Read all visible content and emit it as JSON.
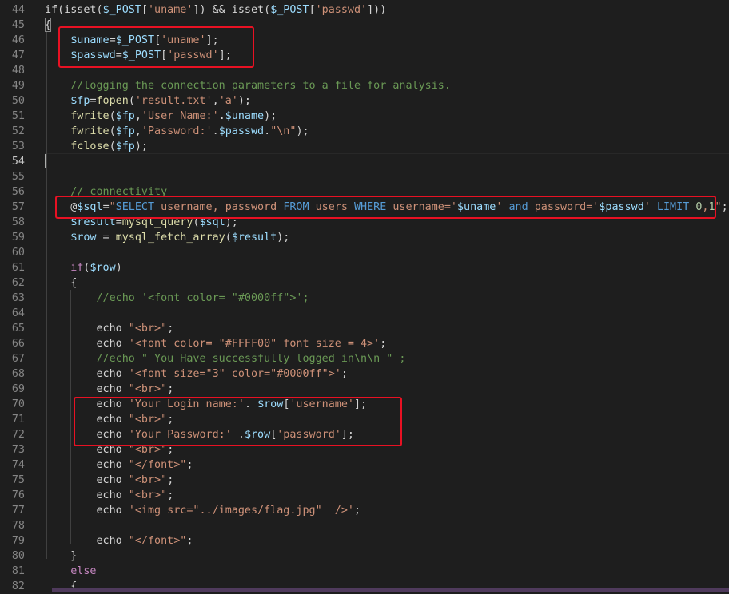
{
  "colors": {
    "background": "#1e1e1e",
    "line_number": "#858585",
    "highlight_box": "#e81123",
    "keyword": "#569cd6",
    "control": "#c586c0",
    "variable": "#9cdcfe",
    "function": "#dcdcaa",
    "string": "#ce9178",
    "comment": "#6a9955",
    "number": "#b5cea8"
  },
  "cursor_line": 54,
  "editor": {
    "lines": [
      {
        "n": "44",
        "tokens": [
          [
            "pl",
            "if(isset("
          ],
          [
            "var",
            "$_POST"
          ],
          [
            "pl",
            "["
          ],
          [
            "str",
            "'uname'"
          ],
          [
            "pl",
            "]) && isset("
          ],
          [
            "var",
            "$_POST"
          ],
          [
            "pl",
            "["
          ],
          [
            "str",
            "'passwd'"
          ],
          [
            "pl",
            "]))"
          ]
        ]
      },
      {
        "n": "45",
        "tokens": [
          [
            "pl",
            "{"
          ]
        ]
      },
      {
        "n": "46",
        "tokens": [
          [
            "pl",
            "    "
          ],
          [
            "var",
            "$uname"
          ],
          [
            "pl",
            "="
          ],
          [
            "var",
            "$_POST"
          ],
          [
            "pl",
            "["
          ],
          [
            "str",
            "'uname'"
          ],
          [
            "pl",
            "];"
          ]
        ]
      },
      {
        "n": "47",
        "tokens": [
          [
            "pl",
            "    "
          ],
          [
            "var",
            "$passwd"
          ],
          [
            "pl",
            "="
          ],
          [
            "var",
            "$_POST"
          ],
          [
            "pl",
            "["
          ],
          [
            "str",
            "'passwd'"
          ],
          [
            "pl",
            "];"
          ]
        ]
      },
      {
        "n": "48",
        "tokens": []
      },
      {
        "n": "49",
        "tokens": [
          [
            "pl",
            "    "
          ],
          [
            "cm",
            "//logging the connection parameters to a file for analysis."
          ]
        ]
      },
      {
        "n": "50",
        "tokens": [
          [
            "pl",
            "    "
          ],
          [
            "var",
            "$fp"
          ],
          [
            "pl",
            "="
          ],
          [
            "fn",
            "fopen"
          ],
          [
            "pl",
            "("
          ],
          [
            "str",
            "'result.txt'"
          ],
          [
            "pl",
            ","
          ],
          [
            "str",
            "'a'"
          ],
          [
            "pl",
            ");"
          ]
        ]
      },
      {
        "n": "51",
        "tokens": [
          [
            "pl",
            "    "
          ],
          [
            "fn",
            "fwrite"
          ],
          [
            "pl",
            "("
          ],
          [
            "var",
            "$fp"
          ],
          [
            "pl",
            ","
          ],
          [
            "str",
            "'User Name:'"
          ],
          [
            "pl",
            "."
          ],
          [
            "var",
            "$uname"
          ],
          [
            "pl",
            ");"
          ]
        ]
      },
      {
        "n": "52",
        "tokens": [
          [
            "pl",
            "    "
          ],
          [
            "fn",
            "fwrite"
          ],
          [
            "pl",
            "("
          ],
          [
            "var",
            "$fp"
          ],
          [
            "pl",
            ","
          ],
          [
            "str",
            "'Password:'"
          ],
          [
            "pl",
            "."
          ],
          [
            "var",
            "$passwd"
          ],
          [
            "pl",
            "."
          ],
          [
            "str",
            "\"\\n\""
          ],
          [
            "pl",
            ");"
          ]
        ]
      },
      {
        "n": "53",
        "tokens": [
          [
            "pl",
            "    "
          ],
          [
            "fn",
            "fclose"
          ],
          [
            "pl",
            "("
          ],
          [
            "var",
            "$fp"
          ],
          [
            "pl",
            ");"
          ]
        ]
      },
      {
        "n": "54",
        "tokens": []
      },
      {
        "n": "55",
        "tokens": []
      },
      {
        "n": "56",
        "tokens": [
          [
            "pl",
            "    "
          ],
          [
            "cm",
            "// connectivity"
          ]
        ]
      },
      {
        "n": "57",
        "tokens": [
          [
            "pl",
            "    @"
          ],
          [
            "var",
            "$sql"
          ],
          [
            "pl",
            "="
          ],
          [
            "str",
            "\""
          ],
          [
            "kw",
            "SELECT"
          ],
          [
            "str",
            " username, password "
          ],
          [
            "kw",
            "FROM"
          ],
          [
            "str",
            " users "
          ],
          [
            "kw",
            "WHERE"
          ],
          [
            "str",
            " username='"
          ],
          [
            "var",
            "$uname"
          ],
          [
            "str",
            "' "
          ],
          [
            "kw",
            "and"
          ],
          [
            "str",
            " password='"
          ],
          [
            "var",
            "$passwd"
          ],
          [
            "str",
            "' "
          ],
          [
            "kw",
            "LIMIT"
          ],
          [
            "str",
            " "
          ],
          [
            "num",
            "0"
          ],
          [
            "str",
            ","
          ],
          [
            "num",
            "1"
          ],
          [
            "str",
            "\""
          ],
          [
            "pl",
            ";"
          ]
        ]
      },
      {
        "n": "58",
        "tokens": [
          [
            "pl",
            "    "
          ],
          [
            "var",
            "$result"
          ],
          [
            "pl",
            "="
          ],
          [
            "fn",
            "mysql_query"
          ],
          [
            "pl",
            "("
          ],
          [
            "var",
            "$sql"
          ],
          [
            "pl",
            ");"
          ]
        ]
      },
      {
        "n": "59",
        "tokens": [
          [
            "pl",
            "    "
          ],
          [
            "var",
            "$row"
          ],
          [
            "pl",
            " = "
          ],
          [
            "fn",
            "mysql_fetch_array"
          ],
          [
            "pl",
            "("
          ],
          [
            "var",
            "$result"
          ],
          [
            "pl",
            ");"
          ]
        ]
      },
      {
        "n": "60",
        "tokens": []
      },
      {
        "n": "61",
        "tokens": [
          [
            "pl",
            "    "
          ],
          [
            "ctl",
            "if"
          ],
          [
            "pl",
            "("
          ],
          [
            "var",
            "$row"
          ],
          [
            "pl",
            ")"
          ]
        ]
      },
      {
        "n": "62",
        "tokens": [
          [
            "pl",
            "    {"
          ]
        ]
      },
      {
        "n": "63",
        "tokens": [
          [
            "pl",
            "        "
          ],
          [
            "cm",
            "//echo '<font color= \"#0000ff\">';"
          ]
        ]
      },
      {
        "n": "64",
        "tokens": []
      },
      {
        "n": "65",
        "tokens": [
          [
            "pl",
            "        echo "
          ],
          [
            "str",
            "\"<br>\""
          ],
          [
            "pl",
            ";"
          ]
        ]
      },
      {
        "n": "66",
        "tokens": [
          [
            "pl",
            "        echo "
          ],
          [
            "str",
            "'<font color= \"#FFFF00\" font size = 4>'"
          ],
          [
            "pl",
            ";"
          ]
        ]
      },
      {
        "n": "67",
        "tokens": [
          [
            "pl",
            "        "
          ],
          [
            "cm",
            "//echo \" You Have successfully logged in\\n\\n \" ;"
          ]
        ]
      },
      {
        "n": "68",
        "tokens": [
          [
            "pl",
            "        echo "
          ],
          [
            "str",
            "'<font size=\"3\" color=\"#0000ff\">'"
          ],
          [
            "pl",
            ";"
          ]
        ]
      },
      {
        "n": "69",
        "tokens": [
          [
            "pl",
            "        echo "
          ],
          [
            "str",
            "\"<br>\""
          ],
          [
            "pl",
            ";"
          ]
        ]
      },
      {
        "n": "70",
        "tokens": [
          [
            "pl",
            "        echo "
          ],
          [
            "str",
            "'Your Login name:'"
          ],
          [
            "pl",
            ". "
          ],
          [
            "var",
            "$row"
          ],
          [
            "pl",
            "["
          ],
          [
            "str",
            "'username'"
          ],
          [
            "pl",
            "];"
          ]
        ]
      },
      {
        "n": "71",
        "tokens": [
          [
            "pl",
            "        echo "
          ],
          [
            "str",
            "\"<br>\""
          ],
          [
            "pl",
            ";"
          ]
        ]
      },
      {
        "n": "72",
        "tokens": [
          [
            "pl",
            "        echo "
          ],
          [
            "str",
            "'Your Password:'"
          ],
          [
            "pl",
            " ."
          ],
          [
            "var",
            "$row"
          ],
          [
            "pl",
            "["
          ],
          [
            "str",
            "'password'"
          ],
          [
            "pl",
            "];"
          ]
        ]
      },
      {
        "n": "73",
        "tokens": [
          [
            "pl",
            "        echo "
          ],
          [
            "str",
            "\"<br>\""
          ],
          [
            "pl",
            ";"
          ]
        ]
      },
      {
        "n": "74",
        "tokens": [
          [
            "pl",
            "        echo "
          ],
          [
            "str",
            "\"</font>\""
          ],
          [
            "pl",
            ";"
          ]
        ]
      },
      {
        "n": "75",
        "tokens": [
          [
            "pl",
            "        echo "
          ],
          [
            "str",
            "\"<br>\""
          ],
          [
            "pl",
            ";"
          ]
        ]
      },
      {
        "n": "76",
        "tokens": [
          [
            "pl",
            "        echo "
          ],
          [
            "str",
            "\"<br>\""
          ],
          [
            "pl",
            ";"
          ]
        ]
      },
      {
        "n": "77",
        "tokens": [
          [
            "pl",
            "        echo "
          ],
          [
            "str",
            "'<img src=\"../images/flag.jpg\"  />'"
          ],
          [
            "pl",
            ";"
          ]
        ]
      },
      {
        "n": "78",
        "tokens": []
      },
      {
        "n": "79",
        "tokens": [
          [
            "pl",
            "        echo "
          ],
          [
            "str",
            "\"</font>\""
          ],
          [
            "pl",
            ";"
          ]
        ]
      },
      {
        "n": "80",
        "tokens": [
          [
            "pl",
            "    }"
          ]
        ]
      },
      {
        "n": "81",
        "tokens": [
          [
            "pl",
            "    "
          ],
          [
            "ctl",
            "else"
          ]
        ]
      },
      {
        "n": "82",
        "tokens": [
          [
            "pl",
            "    {"
          ]
        ]
      }
    ]
  }
}
